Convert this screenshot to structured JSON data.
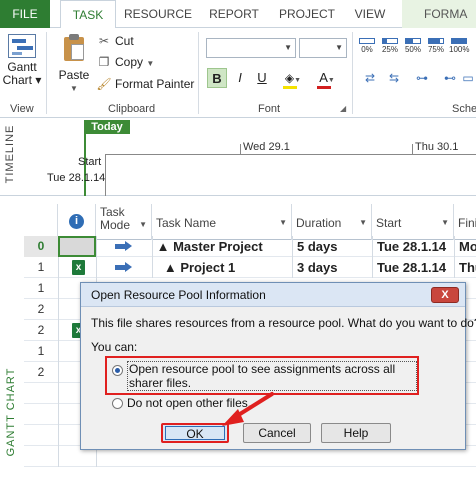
{
  "tabs": {
    "file": "FILE",
    "task": "TASK",
    "resource": "RESOURCE",
    "report": "REPORT",
    "project": "PROJECT",
    "view": "VIEW",
    "format": "FORMA"
  },
  "ribbon": {
    "gantt_label_line1": "Gantt",
    "gantt_label_line2": "Chart",
    "view_group": "View",
    "paste_label": "Paste",
    "cut_label": "Cut",
    "copy_label": "Copy",
    "format_painter_label": "Format Painter",
    "clipboard_group": "Clipboard",
    "font_name_value": "",
    "font_size_value": "",
    "bold": "B",
    "italic": "I",
    "underline": "U",
    "font_color_letter": "A",
    "font_group": "Font",
    "schedule_group": "Sche",
    "percent_buttons": [
      "0%",
      "25%",
      "50%",
      "75%",
      "100%"
    ],
    "percent_values": [
      0,
      25,
      50,
      75,
      100
    ],
    "highlight_color": "#f5e200",
    "font_color": "#d21f1f"
  },
  "timeline": {
    "side_label": "TIMELINE",
    "today": "Today",
    "date1": "Wed 29.1",
    "date2": "Thu 30.1",
    "start_label": "Start",
    "start_date": "Tue 28.1.14",
    "accent": "#3d8b36"
  },
  "grid": {
    "side_label": "GANTT CHART",
    "headers": {
      "mode_line1": "Task",
      "mode_line2": "Mode",
      "name": "Task Name",
      "duration": "Duration",
      "start": "Start",
      "finish": "Fini"
    },
    "rows": [
      {
        "id": "0",
        "name": "Master Project",
        "duration": "5 days",
        "start": "Tue 28.1.14",
        "finish": "Mo"
      },
      {
        "id": "1",
        "name": "Project 1",
        "duration": "3 days",
        "start": "Tue 28.1.14",
        "finish": "Thu"
      },
      {
        "id": "1",
        "name": "",
        "duration": "",
        "start": "",
        "finish": ""
      },
      {
        "id": "2",
        "name": "",
        "duration": "",
        "start": "",
        "finish": ""
      },
      {
        "id": "2",
        "name": "",
        "duration": "",
        "start": "",
        "finish": ""
      },
      {
        "id": "1",
        "name": "",
        "duration": "",
        "start": "",
        "finish": ""
      },
      {
        "id": "2",
        "name": "",
        "duration": "",
        "start": "",
        "finish": ""
      }
    ]
  },
  "dialog": {
    "title": "Open Resource Pool Information",
    "close": "X",
    "message": "This file shares resources from a resource pool. What do you want to do?",
    "you_can": "You can:",
    "option1": "Open resource pool to see assignments across all sharer files.",
    "option2": "Do not open other files.",
    "option1_selected": true,
    "ok": "OK",
    "cancel": "Cancel",
    "help": "Help",
    "highlight_color": "#e0201f"
  }
}
